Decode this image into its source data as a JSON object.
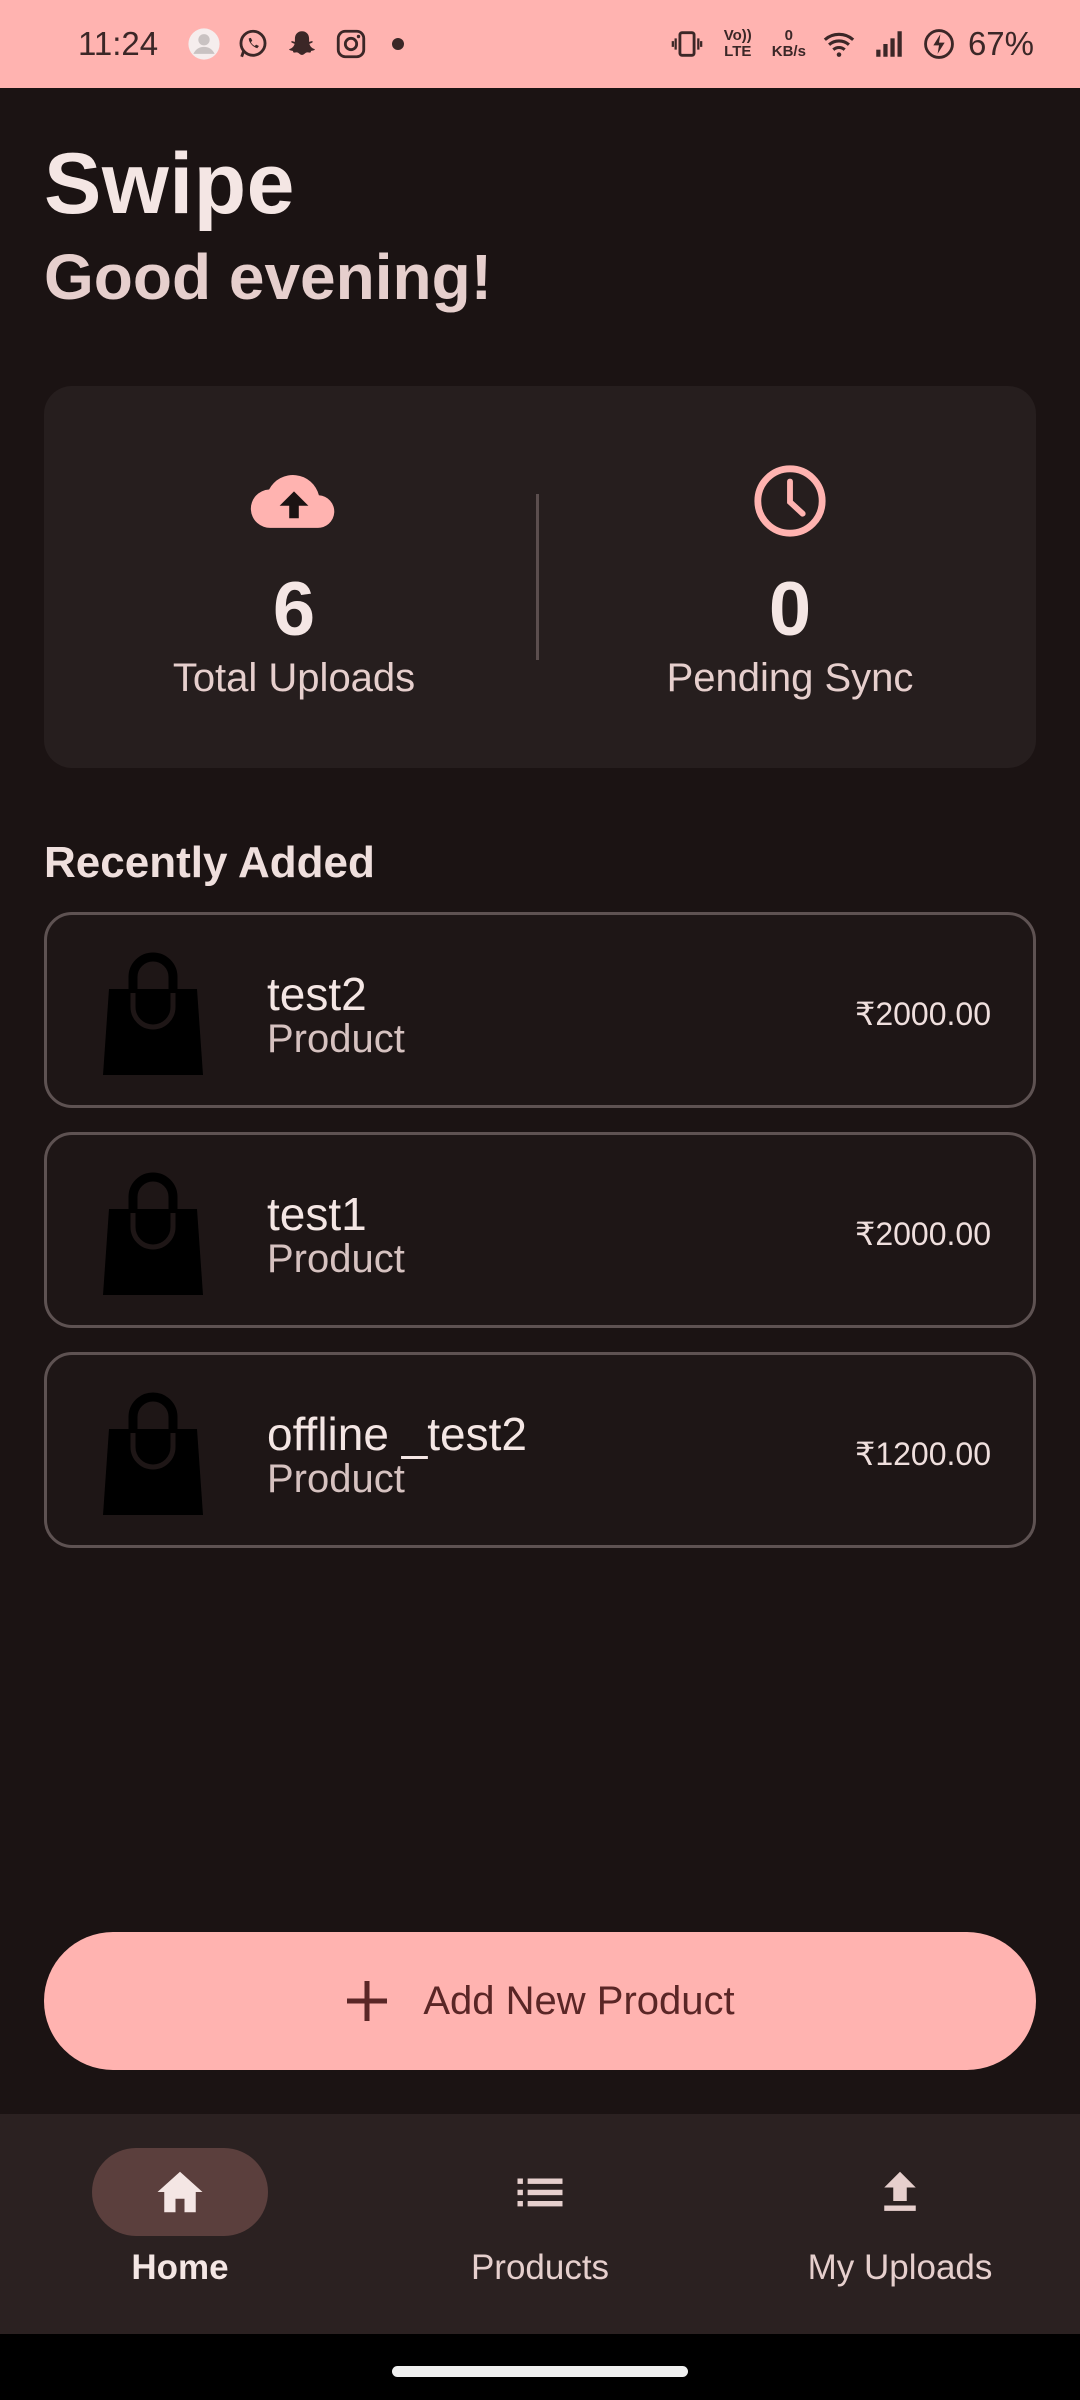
{
  "status_bar": {
    "time": "11:24",
    "notification_icons": [
      "avatar-icon",
      "whatsapp-icon",
      "snapchat-icon",
      "instagram-icon"
    ],
    "volte": "Vo)) LTE",
    "net_speed_value": "0",
    "net_speed_unit": "KB/s",
    "battery": "67%"
  },
  "header": {
    "app_title": "Swipe",
    "greeting": "Good evening!"
  },
  "stats": {
    "total_uploads_value": "6",
    "total_uploads_label": "Total Uploads",
    "pending_sync_value": "0",
    "pending_sync_label": "Pending Sync"
  },
  "recent": {
    "title": "Recently Added",
    "items": [
      {
        "name": "test2",
        "type": "Product",
        "price": "₹2000.00"
      },
      {
        "name": "test1",
        "type": "Product",
        "price": "₹2000.00"
      },
      {
        "name": "offline _test2",
        "type": "Product",
        "price": "₹1200.00"
      }
    ]
  },
  "add_button": {
    "label": "Add New Product"
  },
  "bottom_nav": {
    "items": [
      {
        "label": "Home",
        "icon": "home-icon",
        "active": true
      },
      {
        "label": "Products",
        "icon": "list-icon",
        "active": false
      },
      {
        "label": "My Uploads",
        "icon": "upload-icon",
        "active": false
      }
    ]
  },
  "colors": {
    "accent": "#ffb3b0",
    "background": "#1b1313",
    "card": "#261e1e"
  }
}
